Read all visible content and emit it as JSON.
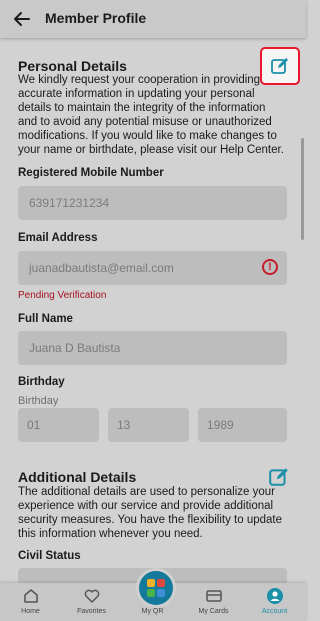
{
  "header": {
    "title": "Member Profile"
  },
  "personal": {
    "title": "Personal Details",
    "description_lines": [
      "We kindly request your cooperation in providing",
      "accurate information in updating your personal",
      "details to maintain the integrity of the information",
      "and to avoid any potential misuse or unauthorized",
      "modifications. If you would like to make changes to",
      "your name or birthdate, please visit our Help Center."
    ]
  },
  "fields": {
    "mobile_label": "Registered Mobile Number",
    "mobile_value": "639171231234",
    "email_label": "Email Address",
    "email_value": "juanadbautista@email.com",
    "email_status": "Pending Verification",
    "name_label": "Full Name",
    "name_value": "Juana D Bautista",
    "birthday_label": "Birthday",
    "birthday_sublabel": "Birthday",
    "birth_month": "01",
    "birth_day": "13",
    "birth_year": "1989"
  },
  "additional": {
    "title": "Additional Details",
    "description_lines": [
      "The additional details are used to personalize your",
      "experience with our service and provide additional",
      "security measures. You have the flexibility to update",
      "this information whenever you need."
    ],
    "civil_status_label": "Civil Status"
  },
  "nav": {
    "home": "Home",
    "favorites": "Favorites",
    "qr": "My QR",
    "cards": "My Cards",
    "account": "Account"
  },
  "colors": {
    "accent": "#1a8fa8",
    "error": "#c41d2b",
    "highlight": "#e8172c"
  }
}
